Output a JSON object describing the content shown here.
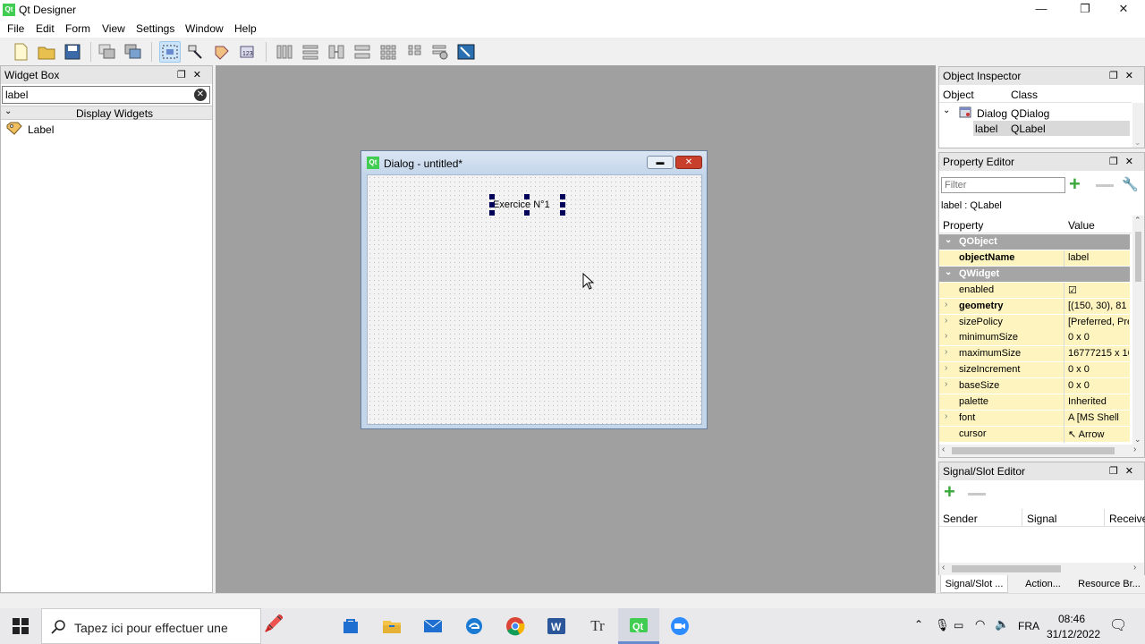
{
  "app": {
    "title": "Qt Designer",
    "icon_text": "Qt"
  },
  "window_controls": {
    "minimize": "—",
    "maximize": "❐",
    "close": "✕"
  },
  "menu": [
    "File",
    "Edit",
    "Form",
    "View",
    "Settings",
    "Window",
    "Help"
  ],
  "widget_box": {
    "title": "Widget Box",
    "filter_value": "label",
    "category": "Display Widgets",
    "items": [
      {
        "label": "Label",
        "icon": "tag-icon"
      }
    ]
  },
  "dialog": {
    "title": "Dialog - untitled*",
    "icon_text": "Qt",
    "label_text": "Exercice N°1"
  },
  "object_inspector": {
    "title": "Object Inspector",
    "headers": [
      "Object",
      "Class"
    ],
    "rows": [
      {
        "object": "Dialog",
        "class": "QDialog"
      },
      {
        "object": "label",
        "class": "QLabel"
      }
    ]
  },
  "property_editor": {
    "title": "Property Editor",
    "filter_placeholder": "Filter",
    "context": "label : QLabel",
    "headers": [
      "Property",
      "Value"
    ],
    "rows": [
      {
        "name": "QObject",
        "value": "",
        "group": true
      },
      {
        "name": "objectName",
        "value": "label",
        "bold": true
      },
      {
        "name": "QWidget",
        "value": "",
        "group": true
      },
      {
        "name": "enabled",
        "value": "☑"
      },
      {
        "name": "geometry",
        "value": "[(150, 30), 81 x",
        "bold": true,
        "expand": true
      },
      {
        "name": "sizePolicy",
        "value": "[Preferred, Pre",
        "expand": true
      },
      {
        "name": "minimumSize",
        "value": "0 x 0",
        "expand": true
      },
      {
        "name": "maximumSize",
        "value": "16777215 x 16",
        "expand": true
      },
      {
        "name": "sizeIncrement",
        "value": "0 x 0",
        "expand": true
      },
      {
        "name": "baseSize",
        "value": "0 x 0",
        "expand": true
      },
      {
        "name": "palette",
        "value": "Inherited"
      },
      {
        "name": "font",
        "value": "A  [MS Shell",
        "expand": true
      },
      {
        "name": "cursor",
        "value": "↖  Arrow"
      }
    ]
  },
  "signal_slot": {
    "title": "Signal/Slot Editor",
    "headers": [
      "Sender",
      "Signal",
      "Receive"
    ],
    "tabs": [
      "Signal/Slot ...",
      "Action...",
      "Resource Br..."
    ]
  },
  "taskbar": {
    "search_placeholder": "Tapez ici pour effectuer une",
    "language": "FRA",
    "time": "08:46",
    "date": "31/12/2022"
  }
}
